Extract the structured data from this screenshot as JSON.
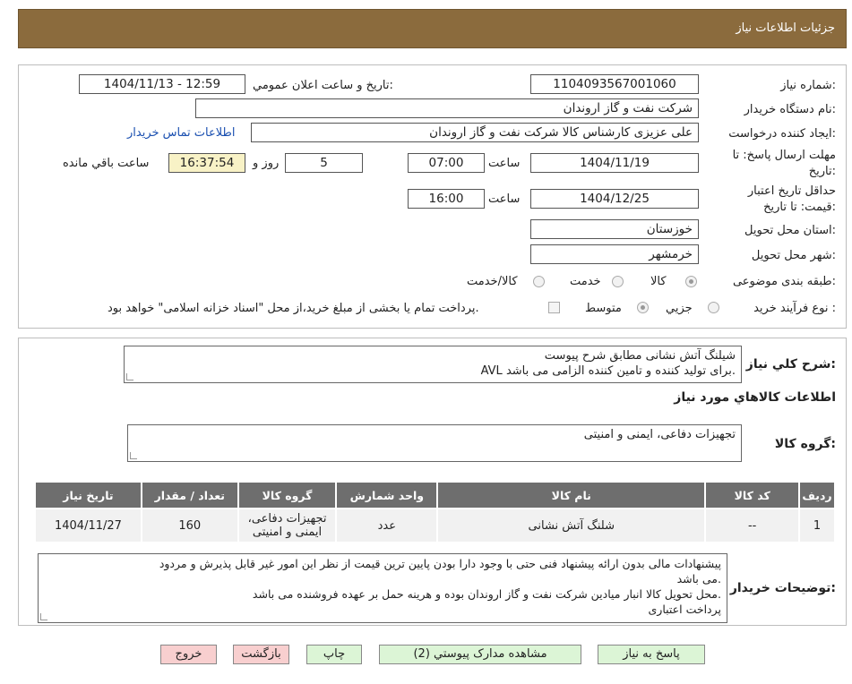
{
  "header": {
    "title": "جزئیات اطلاعات نیاز"
  },
  "form": {
    "need_number_label": "شماره نیاز:",
    "need_number": "1104093567001060",
    "announce_label": "تاریخ و ساعت اعلان عمومي:",
    "announce_value": "1404/11/13 - 12:59",
    "buyer_org_label": "نام دستگاه خریدار:",
    "buyer_org": "شرکت نفت و گاز اروندان",
    "requester_label": "ایجاد کننده درخواست:",
    "requester": "علی عزیزی کارشناس کالا شرکت نفت و گاز اروندان",
    "contact_link": "اطلاعات تماس خریدار",
    "deadline_label_1": "مهلت ارسال پاسخ: تا",
    "deadline_label_2": "تاریخ:",
    "deadline_date": "1404/11/19",
    "time_label": "ساعت",
    "deadline_time": "07:00",
    "days_value": "5",
    "days_label": "روز و",
    "remaining_time": "16:37:54",
    "remaining_label": "ساعت باقي مانده",
    "validity_label_1": "حداقل تاريخ اعتبار",
    "validity_label_2": "قيمت: تا تاريخ:",
    "validity_date": "1404/12/25",
    "validity_time": "16:00",
    "province_label": "استان محل تحویل:",
    "province": "خوزستان",
    "city_label": "شهر محل تحویل:",
    "city": "خرمشهر",
    "category_label": "طبقه بندی موضوعی:",
    "category_options": [
      "کالا",
      "خدمت",
      "کالا/خدمت"
    ],
    "process_label": "نوع فرآیند خرید :",
    "process_options": [
      "جزیي",
      "متوسط"
    ],
    "payment_note": "پرداخت تمام یا بخشی از مبلغ خرید،از محل \"اسناد خزانه اسلامی\" خواهد بود."
  },
  "description": {
    "label": "شرح کلي نياز:",
    "line1": "شیلنگ آتش نشانی مطابق شرح پیوست",
    "line2": "AVL برای تولید کننده و تامین کننده الزامی می باشد."
  },
  "goods": {
    "section_title": "اطلاعات کالاهاي مورد نياز",
    "group_label": "گروه کالا:",
    "group_value": "تجهیزات دفاعی، ایمنی و امنیتی"
  },
  "table": {
    "headers": [
      "رديف",
      "کد کالا",
      "نام کالا",
      "واحد شمارش",
      "گروه کالا",
      "تعداد / مقدار",
      "تاریخ نیاز"
    ],
    "rows": [
      [
        "1",
        "--",
        "شلنگ آتش نشانی",
        "عدد",
        "تجهیزات دفاعی، ایمنی و امنیتی",
        "160",
        "1404/11/27"
      ]
    ]
  },
  "buyer_notes": {
    "label": "توضیحات خریدار:",
    "line1": "پیشنهادات مالی بدون ارائه پیشنهاد فنی حتی با وجود دارا بودن پایین ترین قیمت از نظر این امور غیر قابل پذیرش و مردود",
    "line2": "می باشد.",
    "line3": "محل تحویل کالا انبار میادین شرکت نفت و گاز اروندان بوده و هرینه حمل بر عهده فروشنده می باشد.",
    "line4": "پرداخت اعتباری"
  },
  "buttons": {
    "reply": "پاسخ به نياز",
    "attachments": "مشاهده مدارک پيوستي (2)",
    "print": "چاپ",
    "back": "بازگشت",
    "exit": "خروج"
  },
  "colors": {
    "header": "#8b6b3d",
    "table_header": "#6e6e6e",
    "green_button": "#dcf5d6",
    "pink_button": "#f8cfcf",
    "link": "#1a4fb0"
  }
}
